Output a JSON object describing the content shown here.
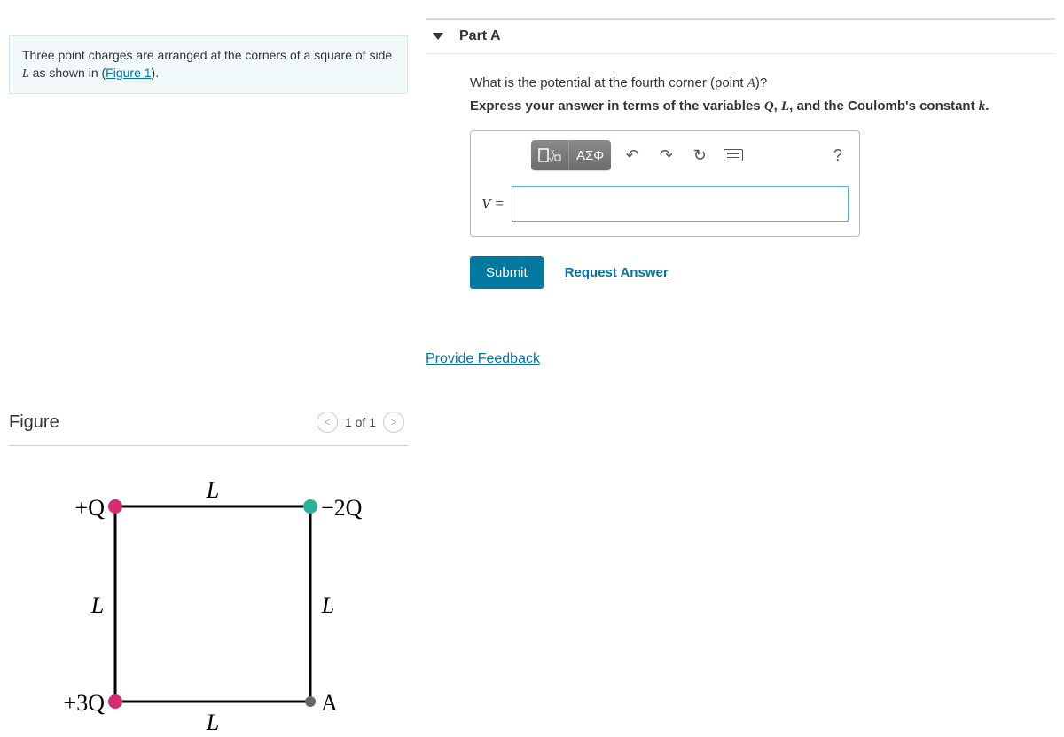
{
  "prompt": {
    "text_before": "Three point charges are arranged at the corners of a square of side ",
    "var": "L",
    "text_mid": " as shown in (",
    "link": "Figure 1",
    "text_after": ")."
  },
  "figure": {
    "title": "Figure",
    "nav_prev": "<",
    "nav_text": "1 of 1",
    "nav_next": ">",
    "charges": {
      "top_left": "+Q",
      "top_right": "−2Q",
      "bottom_left": "+3Q",
      "bottom_right": "A"
    },
    "side_label": "L"
  },
  "part": {
    "label": "Part A",
    "question_before": "What is the potential at the fourth corner (point ",
    "question_var": "A",
    "question_after": ")?",
    "instruction_b1": "Express your answer in terms of the variables ",
    "instruction_v1": "Q",
    "instruction_sep1": ", ",
    "instruction_v2": "L",
    "instruction_sep2": ", and the Coulomb's constant ",
    "instruction_v3": "k",
    "instruction_end": "."
  },
  "toolbar": {
    "template_icon": "▭",
    "fraction_icon": "x√",
    "greek_label": "ΑΣΦ",
    "undo": "↶",
    "redo": "↷",
    "reset": "↻",
    "keyboard": "kbd",
    "help": "?"
  },
  "input": {
    "var_label": "V =",
    "value": ""
  },
  "actions": {
    "submit": "Submit",
    "request": "Request Answer"
  },
  "feedback": "Provide Feedback"
}
